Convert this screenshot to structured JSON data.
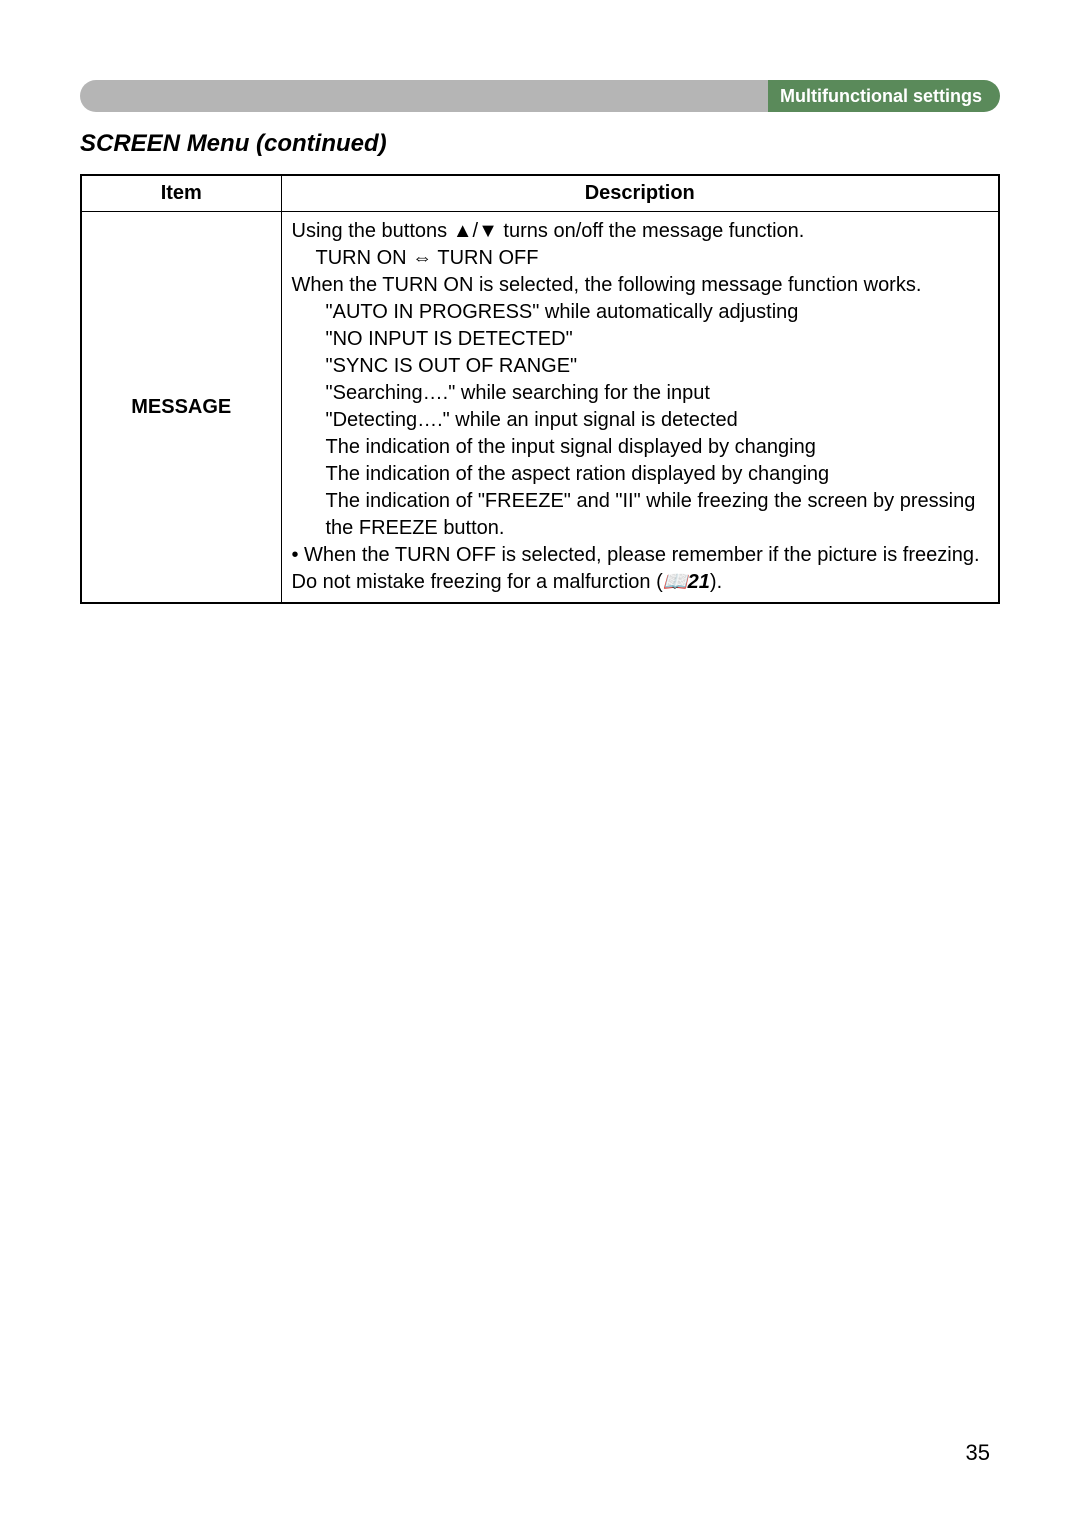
{
  "header": {
    "section": "Multifunctional settings"
  },
  "title": "SCREEN Menu (continued)",
  "table": {
    "headers": {
      "item": "Item",
      "description": "Description"
    },
    "row": {
      "item": "MESSAGE",
      "desc": {
        "l1a": "Using the buttons ",
        "l1b": " turns on/off the message function.",
        "arrows": "▲/▼",
        "l2a": "TURN ON ",
        "l2arrow": "⇔",
        "l2b": " TURN OFF",
        "l3": "When the TURN ON is selected, the following message function works.",
        "l4": "\"AUTO IN PROGRESS\" while automatically adjusting",
        "l5": "\"NO INPUT IS DETECTED\"",
        "l6": "\"SYNC IS OUT OF RANGE\"",
        "l7": "\"Searching….\" while searching for the input",
        "l8": "\"Detecting….\" while an input signal is detected",
        "l9": "The indication of the input signal displayed by changing",
        "l10": "The indication of the aspect ration displayed by changing",
        "l11": "The indication of \"FREEZE\" and \"II\" while freezing the screen by pressing the FREEZE button.",
        "l12a": "• When the TURN OFF is selected, please remember if the picture is freezing. Do not mistake freezing for a malfurction (",
        "l12ref": "📖21",
        "l12b": ")."
      }
    }
  },
  "page_number": "35"
}
